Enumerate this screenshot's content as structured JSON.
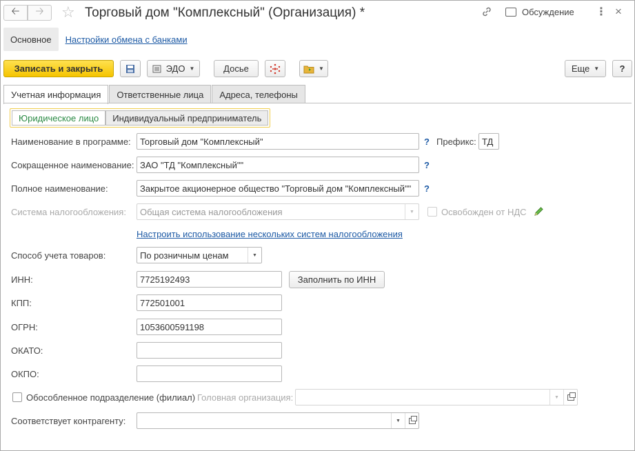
{
  "window": {
    "title": "Торговый дом \"Комплексный\" (Организация) *",
    "discussion_label": "Обсуждение"
  },
  "icons": {
    "back": "arrow-left-icon",
    "forward": "arrow-right-icon",
    "favorite": "star-icon",
    "link": "link-icon",
    "discussion": "chat-icon",
    "more": "kebab-icon",
    "close": "close-icon",
    "save": "floppy-icon",
    "edo": "document-exchange-icon",
    "structure": "structure-icon",
    "folder": "folder-icon",
    "edit": "pencil-icon"
  },
  "section_nav": {
    "main": "Основное",
    "bank_settings": "Настройки обмена с банками"
  },
  "toolbar": {
    "save_close": "Записать и закрыть",
    "edo": "ЭДО",
    "dossier": "Досье",
    "more": "Еще",
    "help": "?"
  },
  "tabs": [
    "Учетная информация",
    "Ответственные лица",
    "Адреса, телефоны"
  ],
  "entity_type": {
    "legal": "Юридическое лицо",
    "individual": "Индивидуальный предприниматель"
  },
  "form": {
    "name_label": "Наименование в программе:",
    "name_value": "Торговый дом \"Комплексный\"",
    "prefix_label": "Префикс:",
    "prefix_value": "ТД",
    "short_name_label": "Сокращенное наименование:",
    "short_name_value": "ЗАО \"ТД \"Комплексный\"\"",
    "full_name_label": "Полное наименование:",
    "full_name_value": "Закрытое акционерное общество \"Торговый дом \"Комплексный\"\"",
    "tax_system_label": "Система налогообложения:",
    "tax_system_value": "Общая система налогообложения",
    "vat_exempt_label": "Освобожден от НДС",
    "tax_systems_link": "Настроить использование нескольких систем налогообложения",
    "accounting_method_label": "Способ учета товаров:",
    "accounting_method_value": "По розничным ценам",
    "inn_label": "ИНН:",
    "inn_value": "7725192493",
    "fill_by_inn": "Заполнить по ИНН",
    "kpp_label": "КПП:",
    "kpp_value": "772501001",
    "ogrn_label": "ОГРН:",
    "ogrn_value": "1053600591198",
    "okato_label": "ОКАТО:",
    "okato_value": "",
    "okpo_label": "ОКПО:",
    "okpo_value": "",
    "branch_label": "Обособленное подразделение (филиал)",
    "head_org_label": "Головная организация:",
    "head_org_value": "",
    "counterparty_label": "Соответствует контрагенту:",
    "counterparty_value": "",
    "help_mark": "?"
  },
  "colors": {
    "primary_button": "#f5c400",
    "link": "#1d5aa5",
    "selected_option": "#2a8a44"
  }
}
